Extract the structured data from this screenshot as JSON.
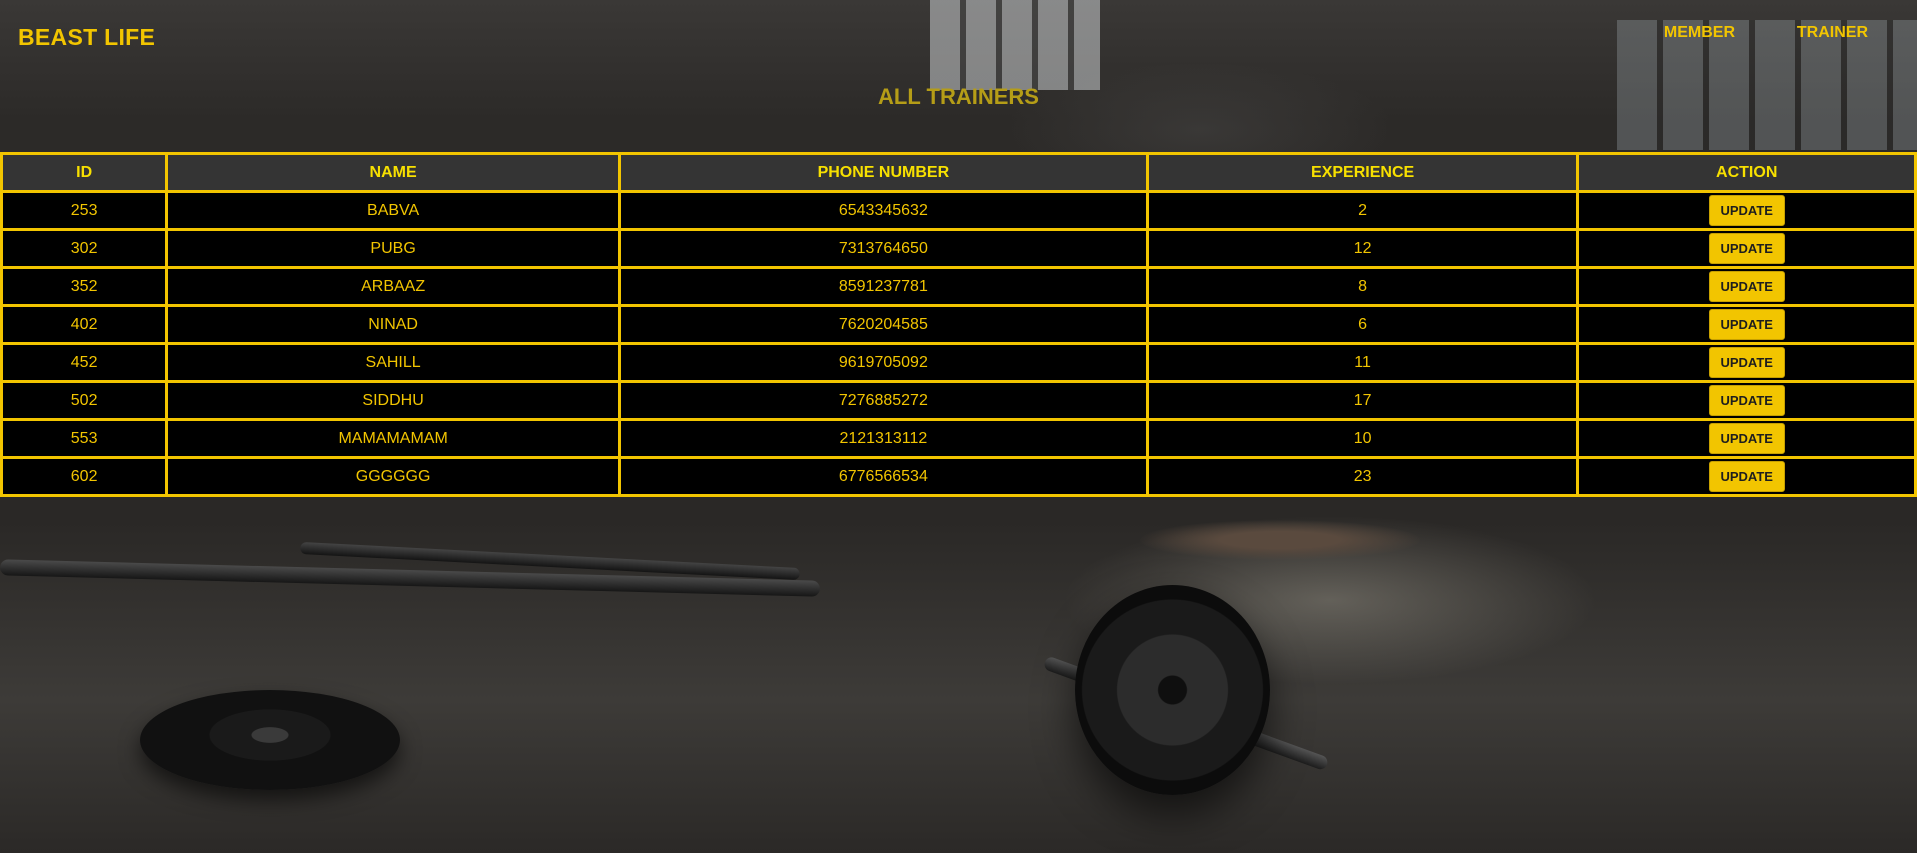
{
  "brand": "BEAST LIFE",
  "nav": {
    "member": "MEMBER",
    "trainer": "TRAINER"
  },
  "page_title": "ALL TRAINERS",
  "table": {
    "headers": {
      "id": "ID",
      "name": "NAME",
      "phone": "PHONE NUMBER",
      "experience": "EXPERIENCE",
      "action": "ACTION"
    },
    "rows": [
      {
        "id": "253",
        "name": "BABVA",
        "phone": "6543345632",
        "experience": "2",
        "action": "UPDATE"
      },
      {
        "id": "302",
        "name": "PUBG",
        "phone": "7313764650",
        "experience": "12",
        "action": "UPDATE"
      },
      {
        "id": "352",
        "name": "ARBAAZ",
        "phone": "8591237781",
        "experience": "8",
        "action": "UPDATE"
      },
      {
        "id": "402",
        "name": "NINAD",
        "phone": "7620204585",
        "experience": "6",
        "action": "UPDATE"
      },
      {
        "id": "452",
        "name": "SAHILL",
        "phone": "9619705092",
        "experience": "11",
        "action": "UPDATE"
      },
      {
        "id": "502",
        "name": "SIDDHU",
        "phone": "7276885272",
        "experience": "17",
        "action": "UPDATE"
      },
      {
        "id": "553",
        "name": "MAMAMAMAM",
        "phone": "2121313112",
        "experience": "10",
        "action": "UPDATE"
      },
      {
        "id": "602",
        "name": "GGGGGG",
        "phone": "6776566534",
        "experience": "23",
        "action": "UPDATE"
      }
    ]
  },
  "colors": {
    "accent": "#f2c500",
    "header_cell_bg": "#343434",
    "row_bg": "#000000",
    "title_color": "#b59d17"
  }
}
